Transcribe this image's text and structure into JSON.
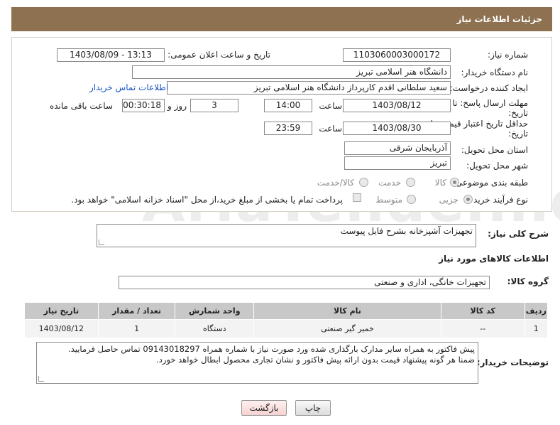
{
  "header": {
    "title": "جزئیات اطلاعات نیاز"
  },
  "fields": {
    "need_number_label": "شماره نیاز:",
    "need_number": "1103060003000172",
    "announce_label": "تاریخ و ساعت اعلان عمومی:",
    "announce_value": "1403/08/09 - 13:13",
    "buyer_label": "نام دستگاه خریدار:",
    "buyer": "دانشگاه هنر اسلامی تبریز",
    "creator_label": "ایجاد کننده درخواست:",
    "creator": "سعید سلطانی اقدم کارپرداز دانشگاه هنر اسلامی تبریز",
    "contact_link": "اطلاعات تماس خریدار",
    "deadline_label": "مهلت ارسال پاسخ: تا",
    "deadline_label2": "تاریخ:",
    "deadline_date": "1403/08/12",
    "time_label": "ساعت",
    "deadline_time": "14:00",
    "days": "3",
    "days_label": "روز و",
    "remaining": "00:30:18",
    "remaining_label": "ساعت باقی مانده",
    "price_valid_label": "حداقل تاریخ اعتبار قیمت: تا",
    "price_valid_label2": "تاریخ:",
    "price_valid_date": "1403/08/30",
    "price_valid_time": "23:59",
    "province_label": "استان محل تحویل:",
    "province": "آذربایجان شرقی",
    "city_label": "شهر محل تحویل:",
    "city": "تبریز",
    "category_label": "طبقه بندی موضوعی:",
    "category_options": [
      "کالا",
      "خدمت",
      "کالا/خدمت"
    ],
    "process_label": "نوع فرآیند خرید :",
    "process_options": [
      "جزیی",
      "متوسط"
    ],
    "payment_note": "پرداخت تمام یا بخشی از مبلغ خرید،از محل \"اسناد خزانه اسلامی\" خواهد بود."
  },
  "description": {
    "label": "شرح کلی نیاز:",
    "value": "تجهیزات آشپزخانه بشرح فایل پیوست"
  },
  "goods_section": {
    "title": "اطلاعات کالاهای مورد نیاز",
    "group_label": "گروه کالا:",
    "group_value": "تجهیزات خانگی، اداری و صنعتی"
  },
  "table": {
    "headers": [
      "ردیف",
      "کد کالا",
      "نام کالا",
      "واحد شمارش",
      "تعداد / مقدار",
      "تاریخ نیاز"
    ],
    "rows": [
      [
        "1",
        "--",
        "خمیر گیر صنعتی",
        "دستگاه",
        "1",
        "1403/08/12"
      ]
    ]
  },
  "buyer_notes": {
    "label": "توضیحات خریدار:",
    "line1": "پیش فاکتور به همراه سایر مدارک بارگذاری شده ورد صورت نیاز با شماره همراه 09143018297 تماس حاصل فرمایید.",
    "line2": "ضمنا هر گونه پیشنهاد قیمت بدون ارائه پیش فاکتور و نشان تجاری محصول ابطال خواهد خورد."
  },
  "buttons": {
    "print": "چاپ",
    "back": "بازگشت"
  },
  "watermark": "AriaTender.neT",
  "colors": {
    "header_bg": "#8d7150",
    "link": "#1a56c4"
  }
}
